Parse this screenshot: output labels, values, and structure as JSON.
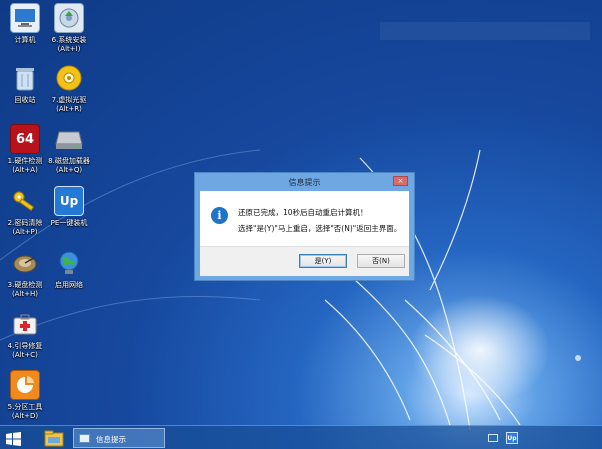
{
  "desktop": {
    "icons": [
      {
        "id": "computer",
        "label": "计算机"
      },
      {
        "id": "sys-install",
        "label": "6.系统安装\n(Alt+I)"
      },
      {
        "id": "recycle",
        "label": "回收站"
      },
      {
        "id": "virtual-drive",
        "label": "7.虚拟光驱\n(Alt+R)"
      },
      {
        "id": "hw-detect",
        "label": "1.硬件检测\n(Alt+A)",
        "badge": "64"
      },
      {
        "id": "disk-loader",
        "label": "8.磁盘加载器\n(Alt+Q)"
      },
      {
        "id": "password",
        "label": "2.密码清除\n(Alt+P)"
      },
      {
        "id": "pe-install",
        "label": "PE一键装机",
        "badge": "Up"
      },
      {
        "id": "disk-check",
        "label": "3.硬盘检测\n(Alt+H)"
      },
      {
        "id": "network",
        "label": "启用网络"
      },
      {
        "id": "boot-repair",
        "label": "4.引导修复\n(Alt+C)"
      },
      {
        "id": "partition",
        "label": "5.分区工具\n(Alt+D)"
      }
    ]
  },
  "dialog": {
    "title": "信息提示",
    "close_label": "×",
    "message_line1": "还原已完成，10秒后自动重启计算机！",
    "message_line2": "选择\"是(Y)\"马上重启，选择\"否(N)\"返回主界面。",
    "yes_label": "是(Y)",
    "no_label": "否(N)"
  },
  "taskbar": {
    "active_task": "信息提示",
    "tray_badge": "Up"
  },
  "colors": {
    "accent": "#1f73c8",
    "dialog_frame": "#6ea7e2",
    "taskbar": "#184e96"
  }
}
